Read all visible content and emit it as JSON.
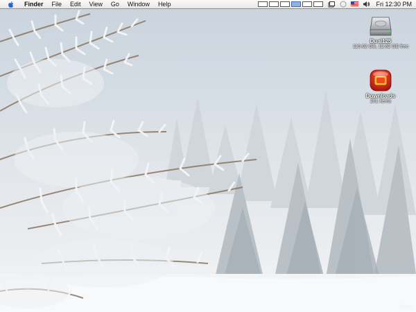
{
  "menubar": {
    "apple_icon": "apple-logo-icon",
    "items": [
      "Finder",
      "File",
      "Edit",
      "View",
      "Go",
      "Window",
      "Help"
    ],
    "clock": "Fri 12:30 PM",
    "spaces_count": 6,
    "tray_icons": [
      "window-icon",
      "bluetooth-icon",
      "flag-icon",
      "volume-icon"
    ]
  },
  "desktop": {
    "icons": [
      {
        "name": "Dual125",
        "sub": "110.02 GB, 12.62 GB free",
        "icon": "hard-drive-icon"
      },
      {
        "name": "Downloads",
        "sub": "251 items",
        "icon": "downloads-folder-icon"
      }
    ],
    "watermark": "Worx"
  },
  "colors": {
    "menubar": "#ececec",
    "sky": "#d1dae2",
    "snow": "#f5f6f7",
    "downloads_red": "#d8231c"
  }
}
